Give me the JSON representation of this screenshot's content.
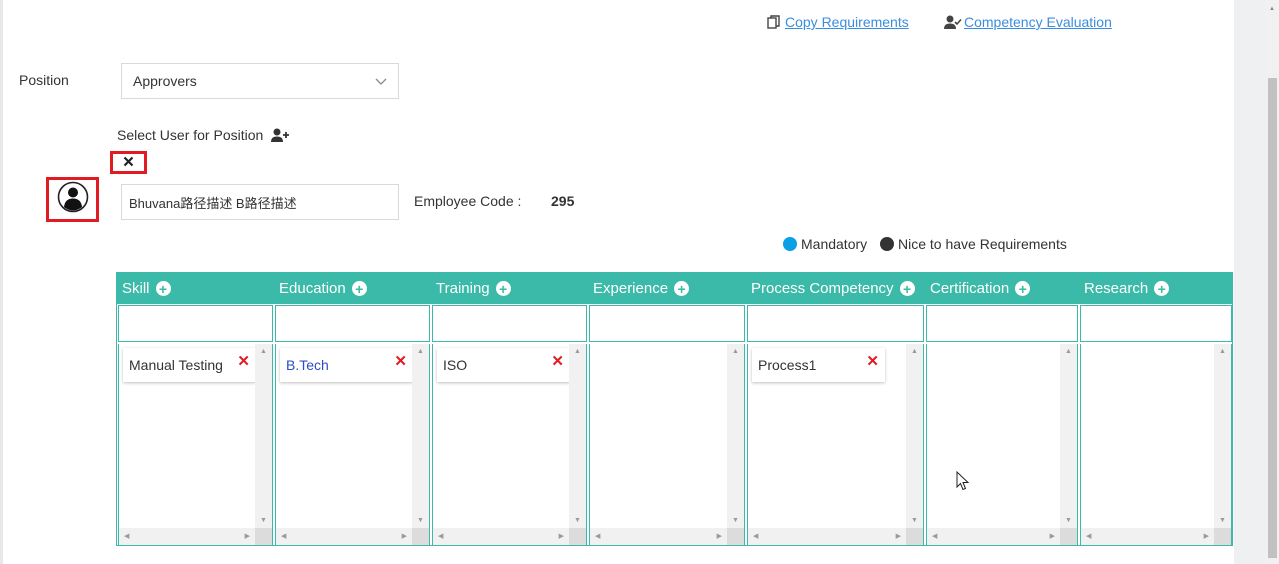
{
  "links": {
    "copy_requirements": "Copy Requirements",
    "competency_evaluation": "Competency Evaluation"
  },
  "position": {
    "label": "Position",
    "selected": "Approvers"
  },
  "select_user": {
    "label": "Select User for Position",
    "user_name": "Bhuvana路径描述 B路径描述",
    "employee_code_label": "Employee Code :",
    "employee_code_value": "295"
  },
  "legend": {
    "mandatory": "Mandatory",
    "nice_to_have": "Nice to have Requirements"
  },
  "colors": {
    "accent_teal": "#3bbaa9",
    "link_blue": "#3a8dde",
    "mandatory_blue": "#0aa0e6",
    "nice_dark": "#333333",
    "remove_red": "#e21b23",
    "highlight_red": "#e21b23"
  },
  "columns": [
    {
      "title": "Skill",
      "items": [
        {
          "text": "Manual Testing",
          "kind": "nice"
        }
      ]
    },
    {
      "title": "Education",
      "items": [
        {
          "text": "B.Tech",
          "kind": "mandatory"
        }
      ]
    },
    {
      "title": "Training",
      "items": [
        {
          "text": "ISO",
          "kind": "nice"
        }
      ]
    },
    {
      "title": "Experience",
      "items": []
    },
    {
      "title": "Process Competency",
      "items": [
        {
          "text": "Process1",
          "kind": "nice"
        }
      ]
    },
    {
      "title": "Certification",
      "items": []
    },
    {
      "title": "Research",
      "items": []
    }
  ],
  "icons": {
    "copy": "copy-icon",
    "evaluation": "user-check-icon",
    "add_user": "user-plus-icon",
    "close": "close-icon",
    "avatar": "user-avatar-icon",
    "chevron": "chevron-down-icon",
    "add_column_item": "plus-circle-icon",
    "remove_item": "remove-x-icon"
  }
}
